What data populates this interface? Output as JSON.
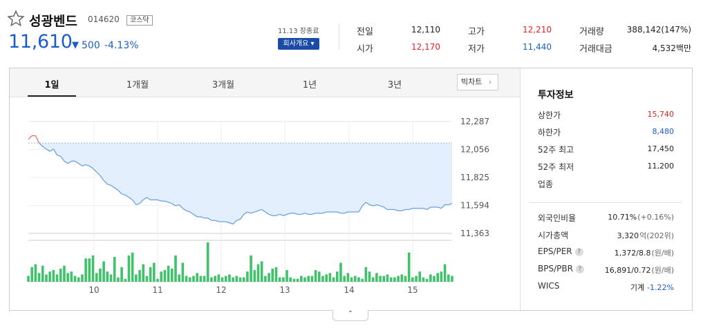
{
  "header": {
    "title": "성광벤드",
    "code": "014620",
    "market": "코스닥",
    "price": "11,610",
    "change_arrow": "▼",
    "change": "500",
    "change_pct": "-4.13%",
    "date_status": "11.13 장종료",
    "overview_button": "회사개요 ▾"
  },
  "quotes": [
    {
      "label": "전일",
      "value": "12,110",
      "color": "#222222"
    },
    {
      "label": "시가",
      "value": "12,170",
      "color": "#e02020"
    },
    {
      "label": "고가",
      "value": "12,210",
      "color": "#e02020"
    },
    {
      "label": "저가",
      "value": "11,440",
      "color": "#1a5dc9"
    },
    {
      "label": "거래량",
      "value": "388,142(147%)",
      "color": "#222222"
    },
    {
      "label": "거래대금",
      "value": "4,532백만",
      "color": "#222222"
    }
  ],
  "tabs": [
    "1일",
    "1개월",
    "3개월",
    "1년",
    "3년"
  ],
  "big_chart_button": "빅차트",
  "info": {
    "title": "투자정보",
    "rows": [
      {
        "label": "상한가",
        "value": "15,740",
        "color": "#e02020"
      },
      {
        "label": "하한가",
        "value": "8,480",
        "color": "#1a5dc9"
      },
      {
        "label": "52주 최고",
        "value": "17,450",
        "color": "#222222"
      },
      {
        "label": "52주 최저",
        "value": "11,200",
        "color": "#222222"
      },
      {
        "label": "업종",
        "value": "",
        "color": "#222222"
      }
    ],
    "rows2": [
      {
        "label": "외국인비율",
        "value": "10.71%",
        "sub": "(+0.16%)",
        "help": false
      },
      {
        "label": "시가총액",
        "value": "3,320",
        "sub": "억(202위)",
        "help": false
      },
      {
        "label": "EPS/PER",
        "value": "1,372/8.8",
        "sub": "(원/배)",
        "help": true
      },
      {
        "label": "BPS/PBR",
        "value": "16,891/0.72",
        "sub": "(원/배)",
        "help": true
      },
      {
        "label": "WICS",
        "value": "기계",
        "sub": "-1.22%",
        "help": false
      }
    ]
  },
  "chart_data": {
    "type": "area",
    "ylim": [
      11363,
      12287
    ],
    "yticks": [
      "12,287",
      "12,056",
      "11,825",
      "11,594",
      "11,363"
    ],
    "xlabels": [
      "10",
      "11",
      "12",
      "13",
      "14",
      "15"
    ],
    "prev_close": 12110,
    "line_color": "#5b9be6",
    "fill_color": "#e3effc",
    "up_color": "#f06060",
    "price": [
      12140,
      12170,
      12170,
      12110,
      12080,
      12060,
      12040,
      12060,
      12010,
      12000,
      11960,
      11940,
      11960,
      11960,
      11940,
      11920,
      11930,
      11920,
      11900,
      11870,
      11840,
      11800,
      11770,
      11760,
      11740,
      11720,
      11690,
      11680,
      11660,
      11640,
      11600,
      11610,
      11640,
      11660,
      11640,
      11640,
      11640,
      11630,
      11630,
      11620,
      11610,
      11590,
      11600,
      11570,
      11550,
      11540,
      11520,
      11500,
      11500,
      11490,
      11490,
      11470,
      11470,
      11460,
      11460,
      11460,
      11450,
      11440,
      11470,
      11480,
      11520,
      11540,
      11530,
      11540,
      11550,
      11560,
      11540,
      11520,
      11510,
      11510,
      11520,
      11510,
      11520,
      11530,
      11530,
      11520,
      11520,
      11530,
      11520,
      11520,
      11530,
      11530,
      11530,
      11540,
      11540,
      11540,
      11540,
      11530,
      11530,
      11540,
      11540,
      11540,
      11540,
      11590,
      11620,
      11600,
      11590,
      11600,
      11590,
      11580,
      11560,
      11560,
      11560,
      11550,
      11550,
      11560,
      11560,
      11570,
      11570,
      11570,
      11570,
      11560,
      11580,
      11580,
      11580,
      11570,
      11600,
      11600,
      11610
    ],
    "volume": [
      4,
      10,
      12,
      6,
      11,
      5,
      7,
      8,
      5,
      9,
      11,
      6,
      7,
      4,
      3,
      5,
      16,
      16,
      18,
      6,
      9,
      14,
      7,
      5,
      17,
      3,
      10,
      2,
      18,
      20,
      5,
      8,
      12,
      4,
      10,
      13,
      2,
      7,
      8,
      11,
      9,
      18,
      5,
      13,
      4,
      3,
      4,
      6,
      4,
      4,
      27,
      3,
      4,
      5,
      3,
      4,
      5,
      3,
      4,
      3,
      3,
      7,
      18,
      8,
      12,
      14,
      4,
      6,
      9,
      10,
      3,
      3,
      8,
      3,
      2,
      2,
      4,
      3,
      4,
      4,
      8,
      7,
      4,
      5,
      6,
      3,
      7,
      13,
      4,
      6,
      3,
      4,
      3,
      2,
      10,
      7,
      3,
      6,
      4,
      4,
      5,
      3,
      3,
      4,
      5,
      4,
      20,
      3,
      4,
      7,
      3,
      2,
      5,
      4,
      6,
      7,
      12,
      5,
      4
    ]
  }
}
